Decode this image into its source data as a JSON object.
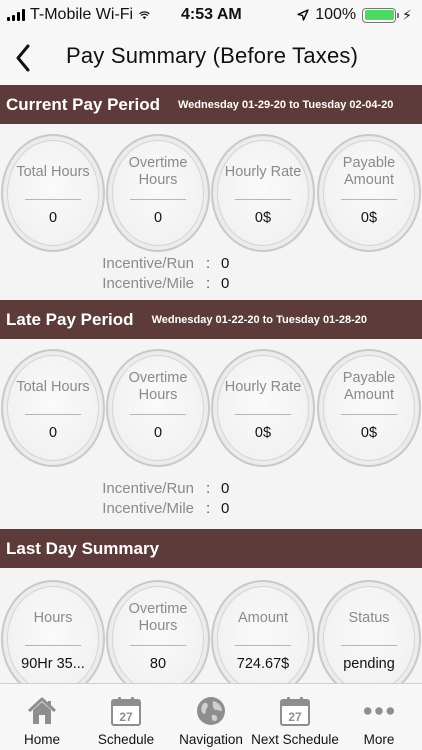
{
  "status_bar": {
    "carrier": "T-Mobile Wi-Fi",
    "time": "4:53 AM",
    "battery": "100%",
    "battery_level": 1.0
  },
  "header": {
    "title": "Pay Summary (Before Taxes)"
  },
  "current": {
    "title": "Current Pay Period",
    "dates": "Wednesday 01-29-20 to Tuesday 02-04-20",
    "c1": {
      "label": "Total Hours",
      "value": "0"
    },
    "c2": {
      "label": "Overtime Hours",
      "value": "0"
    },
    "c3": {
      "label": "Hourly Rate",
      "value": "0$"
    },
    "c4": {
      "label": "Payable Amount",
      "value": "0$"
    },
    "inc_run_label": "Incentive/Run",
    "inc_run_value": "0",
    "inc_mile_label": "Incentive/Mile",
    "inc_mile_value": "0"
  },
  "late": {
    "title": "Late Pay Period",
    "dates": "Wednesday 01-22-20 to Tuesday 01-28-20",
    "c1": {
      "label": "Total Hours",
      "value": "0"
    },
    "c2": {
      "label": "Overtime Hours",
      "value": "0"
    },
    "c3": {
      "label": "Hourly Rate",
      "value": "0$"
    },
    "c4": {
      "label": "Payable Amount",
      "value": "0$"
    },
    "inc_run_label": "Incentive/Run",
    "inc_run_value": "0",
    "inc_mile_label": "Incentive/Mile",
    "inc_mile_value": "0"
  },
  "last_day": {
    "title": "Last Day Summary",
    "c1": {
      "label": "Hours",
      "value": "90Hr 35..."
    },
    "c2": {
      "label": "Overtime Hours",
      "value": "80"
    },
    "c3": {
      "label": "Amount",
      "value": "724.67$"
    },
    "c4": {
      "label": "Status",
      "value": "pending"
    }
  },
  "colon": ":",
  "tabs": {
    "home": "Home",
    "schedule": "Schedule",
    "navigation": "Navigation",
    "next_schedule": "Next Schedule",
    "more": "More",
    "calendar_day": "27"
  },
  "colors": {
    "section_bar": "#5d3b3b",
    "battery": "#4cd964"
  }
}
